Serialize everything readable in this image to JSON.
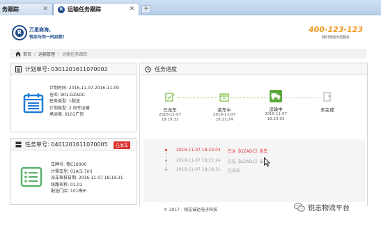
{
  "browser": {
    "tabs": [
      {
        "title": "务跟踪",
        "active": false
      },
      {
        "title": "运输任务跟踪",
        "active": true
      }
    ],
    "new_tab": "+"
  },
  "header": {
    "brand_line1": "万里商海，",
    "brand_line2": "锐志与你一同启航！",
    "hotline": "400-123-123",
    "hotline_sub": "我们随诚为您服务"
  },
  "breadcrumb": [
    "首页",
    "运输管理",
    "运输任务跟踪"
  ],
  "plan_panel": {
    "title": "计划单号: 0301201611070002",
    "fields": [
      "计划时间: 2016-11-07-2016-11-09",
      "仓库: 901.GZADC",
      "任务类型: 1配送",
      "计划类型: 2 自车运输",
      "承运商: 0101广信"
    ]
  },
  "task_panel": {
    "title": "任务单号: 0401201611070005",
    "badge": "已发车",
    "fields": [
      "车牌号: 粤C10000",
      "计需车型: 01A(5.7m)",
      "派车审核日期: 2016-11-07 18:19:31",
      "线路名称: 01.01",
      "配送门店: 101梅州"
    ]
  },
  "progress_panel": {
    "title": "任务进度",
    "steps": [
      {
        "label": "已派车",
        "date": "2016-11-07",
        "time": "18:19:31"
      },
      {
        "label": "装车中",
        "date": "2016-11-07",
        "time": "18:21:24"
      },
      {
        "label": "运输中",
        "date": "2016-11-07",
        "time": "18:23:03"
      },
      {
        "label": "未完成",
        "date": "",
        "time": ""
      }
    ],
    "log": [
      {
        "time": "2016-11-07 18:23:03",
        "text": "已从【GZADC】发车",
        "current": true
      },
      {
        "time": "2016-11-07 18:21:24",
        "text": "已在【GZADC】装车",
        "current": false
      },
      {
        "time": "2016-11-07 18:19:31",
        "text": "已派车",
        "current": false
      }
    ]
  },
  "footer": "© 2017 - 锐志诚达电子科技",
  "watermark": "锐志物流平台",
  "colors": {
    "accent": "#1c4b8c",
    "orange": "#f39a1f",
    "green": "#8fc35a",
    "red": "#d9322c"
  }
}
